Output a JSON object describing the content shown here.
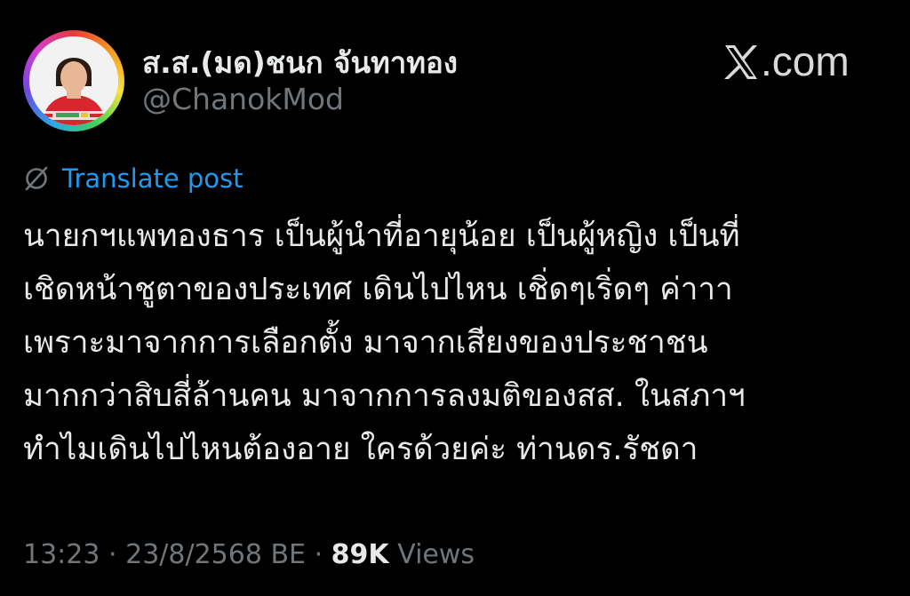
{
  "post": {
    "display_name": "ส.ส.(มด)ชนก จันทาทอง",
    "handle": "@ChanokMod",
    "avatar_icon": "profile-photo",
    "avatar_ring_colors": [
      "#e63b3b",
      "#f59b23",
      "#f7e13b",
      "#3bd15b",
      "#2aa7e8",
      "#6b4be0",
      "#d43bd0"
    ],
    "translate_label": "Translate post",
    "translate_icon": "globe-slash-icon",
    "body_lines": [
      "นายกฯแพทองธาร เป็นผู้นำที่อายุน้อย เป็นผู้หญิง เป็นที่",
      "เชิดหน้าชูตาของประเทศ เดินไปไหน เชิ่ดๆเริ่ดๆ ค่าาา",
      "เพราะมาจากการเลือกตั้ง มาจากเสียงของประชาชน",
      "มากกว่าสิบสี่ล้านคน มาจากการลงมติของสส. ในสภาฯ",
      "ทำไมเดินไปไหนต้องอาย ใครด้วยค่ะ ท่านดร.รัชดา"
    ],
    "time": "13:23",
    "separator": "·",
    "date": "23/8/2568 BE",
    "views_count": "89K",
    "views_label": "Views"
  },
  "brand": {
    "logo_icon": "x-logo-icon",
    "suffix": ".com"
  },
  "colors": {
    "background": "#000000",
    "primary_text": "#e7e9ea",
    "secondary_text": "#71767b",
    "link": "#1d9bf0"
  }
}
